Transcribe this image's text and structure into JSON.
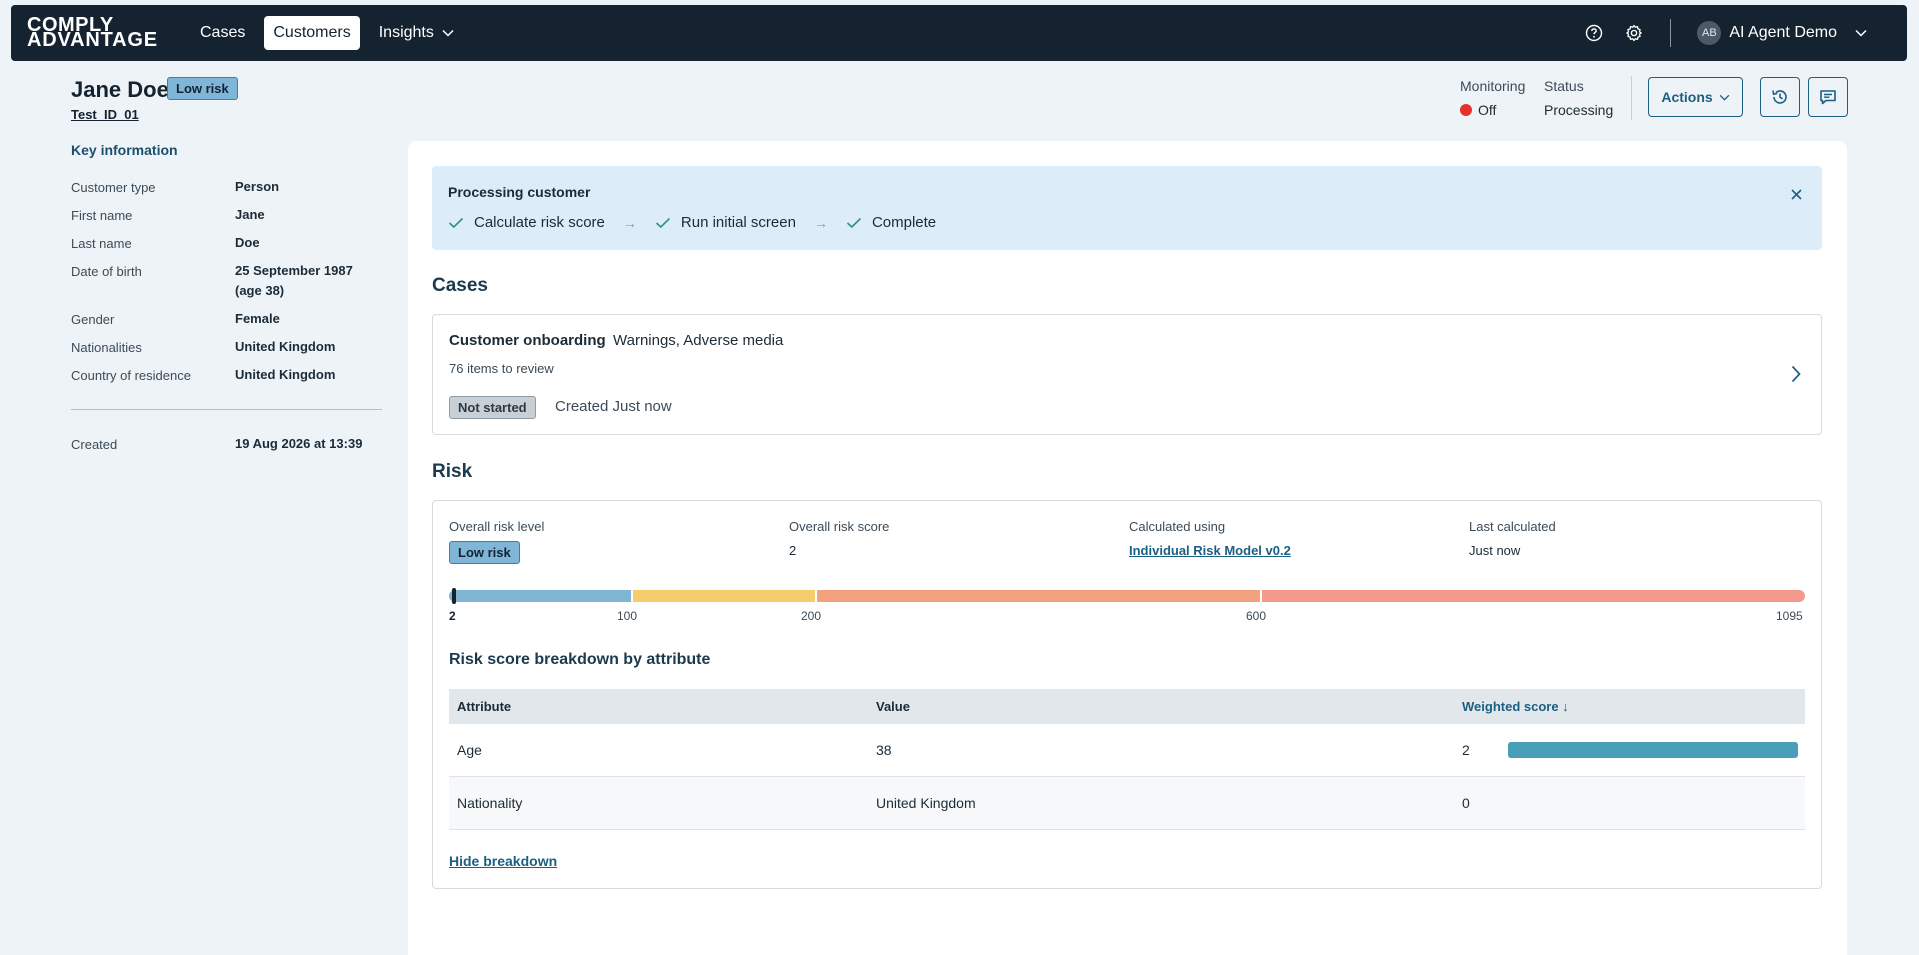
{
  "nav": {
    "logo_line1": "COMPLY",
    "logo_line2": "ADVANTAGE",
    "items": [
      {
        "label": "Cases"
      },
      {
        "label": "Customers"
      },
      {
        "label": "Insights"
      }
    ],
    "user_initials": "AB",
    "user_name": "AI Agent Demo"
  },
  "customer": {
    "name": "Jane Doe",
    "risk_badge": "Low risk",
    "id": "Test_ID_01"
  },
  "header": {
    "monitoring_label": "Monitoring",
    "monitoring_value": "Off",
    "status_label": "Status",
    "status_value": "Processing",
    "actions_label": "Actions"
  },
  "key_info": {
    "title": "Key information",
    "fields": [
      {
        "label": "Customer type",
        "value": "Person"
      },
      {
        "label": "First name",
        "value": "Jane"
      },
      {
        "label": "Last name",
        "value": "Doe"
      },
      {
        "label": "Date of birth",
        "value": "25 September 1987",
        "value2": "(age 38)"
      },
      {
        "label": "Gender",
        "value": "Female"
      },
      {
        "label": "Nationalities",
        "value": "United Kingdom"
      },
      {
        "label": "Country of residence",
        "value": "United Kingdom"
      }
    ],
    "created_label": "Created",
    "created_value": "19 Aug 2026 at 13:39"
  },
  "processing": {
    "title": "Processing customer",
    "steps": [
      "Calculate risk score",
      "Run initial screen",
      "Complete"
    ]
  },
  "cases": {
    "title": "Cases",
    "item": {
      "name": "Customer onboarding",
      "types": "Warnings, Adverse media",
      "items_to_review": "76 items to review",
      "status": "Not started",
      "created": "Created Just now"
    }
  },
  "risk": {
    "title": "Risk",
    "overall_level_label": "Overall risk level",
    "overall_level_value": "Low risk",
    "overall_score_label": "Overall risk score",
    "overall_score_value": "2",
    "calculated_using_label": "Calculated using",
    "calculated_using_value": "Individual Risk Model v0.2",
    "last_calculated_label": "Last calculated",
    "last_calculated_value": "Just now",
    "scale": {
      "ticks": [
        "2",
        "100",
        "200",
        "600",
        "1095"
      ],
      "tick_values": [
        2,
        100,
        200,
        600,
        1095
      ],
      "score": 2,
      "colors": [
        "#7eb6d3",
        "#f5cd6a",
        "#f4a27e",
        "#f49a8d"
      ]
    },
    "breakdown": {
      "title": "Risk score breakdown by attribute",
      "columns": [
        "Attribute",
        "Value",
        "Weighted score ↓"
      ],
      "rows": [
        {
          "attribute": "Age",
          "value": "38",
          "score": "2"
        },
        {
          "attribute": "Nationality",
          "value": "United Kingdom",
          "score": "0"
        }
      ],
      "hide_label": "Hide breakdown"
    }
  }
}
